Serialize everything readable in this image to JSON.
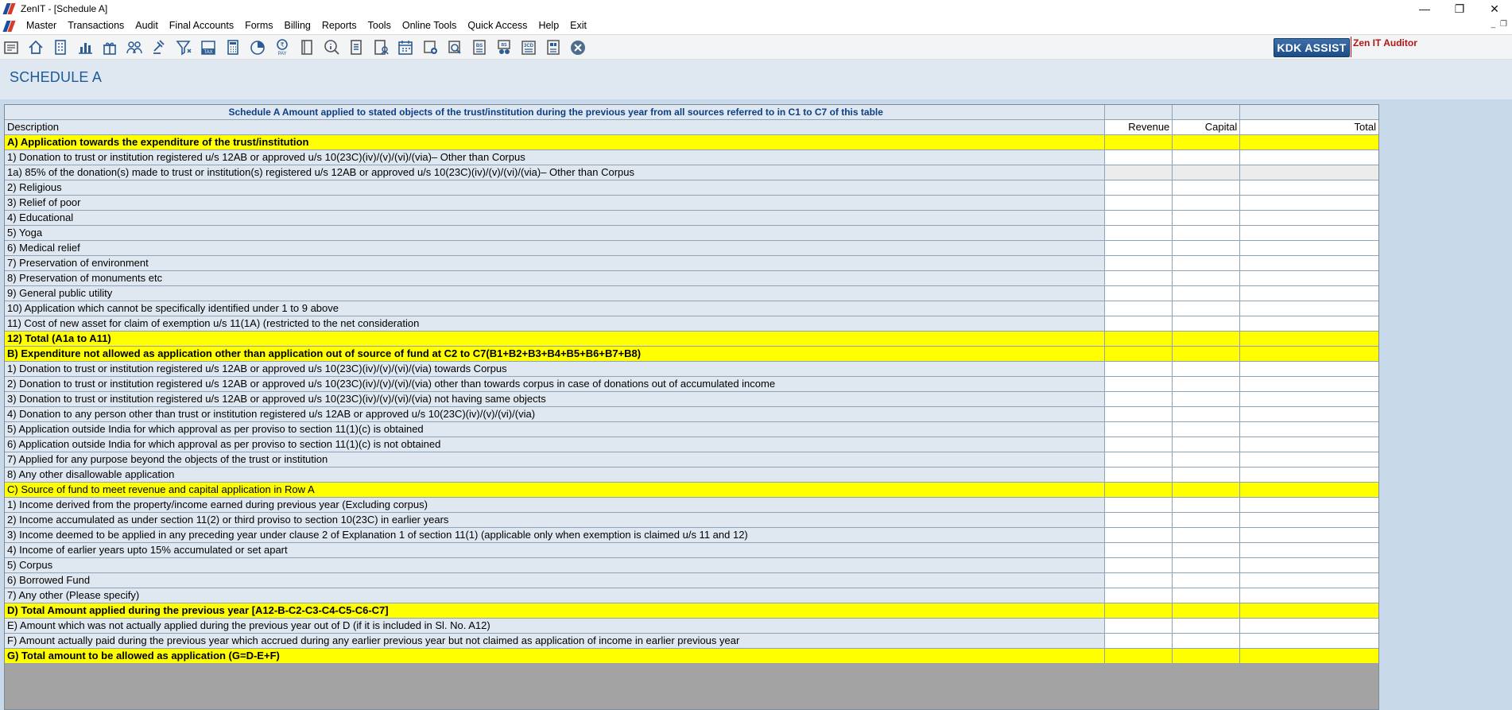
{
  "window": {
    "title": "ZenIT - [Schedule A]",
    "controls": {
      "minimize": "—",
      "restore": "❐",
      "close": "✕"
    }
  },
  "menu": {
    "items": [
      "Master",
      "Transactions",
      "Audit",
      "Final Accounts",
      "Forms",
      "Billing",
      "Reports",
      "Tools",
      "Online Tools",
      "Quick Access",
      "Help",
      "Exit"
    ],
    "mdi": {
      "minimize": "_",
      "restore": "❐"
    }
  },
  "toolbar": {
    "icons": [
      "open-icon",
      "home-icon",
      "building-icon",
      "chart-icon",
      "gift-icon",
      "people-icon",
      "gavel-icon",
      "filter-icon",
      "tax-icon",
      "calculator-icon",
      "pie-icon",
      "pay-icon",
      "book-icon",
      "info-icon",
      "report-icon",
      "user-doc-icon",
      "calendar-icon",
      "add-doc-icon",
      "search-doc-icon",
      "bs-icon",
      "tds-icon",
      "3cd-icon",
      "grid-doc-icon",
      "close-circle-icon"
    ],
    "kdk_label": "KDK ASSIST",
    "zen_label": "Zen IT Auditor"
  },
  "page": {
    "title": "SCHEDULE A"
  },
  "table": {
    "title": "Schedule A Amount applied to stated objects of the trust/institution during the previous year from all sources referred to in C1 to C7 of this table",
    "headers": {
      "description": "Description",
      "revenue": "Revenue",
      "capital": "Capital",
      "total": "Total"
    },
    "rows": [
      {
        "label": "A) Application towards the expenditure of the trust/institution",
        "style": "yellow"
      },
      {
        "label": "1) Donation to trust or institution registered u/s 12AB or approved u/s 10(23C)(iv)/(v)/(vi)/(via)– Other than Corpus",
        "style": "normal"
      },
      {
        "label": "1a) 85% of the donation(s) made to trust or institution(s) registered u/s 12AB or approved u/s  10(23C)(iv)/(v)/(vi)/(via)– Other than Corpus",
        "style": "grey"
      },
      {
        "label": "2) Religious",
        "style": "normal"
      },
      {
        "label": "3) Relief of poor",
        "style": "normal"
      },
      {
        "label": "4) Educational",
        "style": "normal"
      },
      {
        "label": "5) Yoga",
        "style": "normal"
      },
      {
        "label": "6) Medical relief",
        "style": "normal"
      },
      {
        "label": "7) Preservation of environment",
        "style": "normal"
      },
      {
        "label": "8) Preservation of monuments etc",
        "style": "normal"
      },
      {
        "label": "9) General public utility",
        "style": "normal"
      },
      {
        "label": "10) Application which cannot be specifically identified under 1 to 9 above",
        "style": "normal"
      },
      {
        "label": "11) Cost of new asset for claim of exemption u/s 11(1A) (restricted to the net consideration",
        "style": "normal"
      },
      {
        "label": "12) Total (A1a to A11)",
        "style": "yellow"
      },
      {
        "label": "B) Expenditure not allowed as application other than application out of source of fund at C2 to C7(B1+B2+B3+B4+B5+B6+B7+B8)",
        "style": "yellow"
      },
      {
        "label": "1) Donation to trust or institution registered u/s 12AB or approved u/s 10(23C)(iv)/(v)/(vi)/(via) towards Corpus",
        "style": "normal"
      },
      {
        "label": "2) Donation to trust or institution registered u/s 12AB or approved u/s 10(23C)(iv)/(v)/(vi)/(via) other than towards corpus in case of donations out of accumulated income",
        "style": "normal"
      },
      {
        "label": "3) Donation to trust or institution registered u/s 12AB or approved u/s 10(23C)(iv)/(v)/(vi)/(via) not having same objects",
        "style": "normal"
      },
      {
        "label": "4) Donation to any person other than trust or institution registered u/s 12AB or approved u/s 10(23C)(iv)/(v)/(vi)/(via)",
        "style": "normal"
      },
      {
        "label": "5) Application outside India for which approval as per proviso to section 11(1)(c) is obtained",
        "style": "normal"
      },
      {
        "label": "6) Application outside India for which approval as per proviso to section 11(1)(c) is not obtained",
        "style": "normal"
      },
      {
        "label": "7) Applied for any purpose beyond the objects of the trust or institution",
        "style": "normal"
      },
      {
        "label": "8) Any other disallowable application",
        "style": "normal"
      },
      {
        "label": "C) Source of fund to meet revenue and capital application in Row A",
        "style": "yellow-plain"
      },
      {
        "label": "1) Income derived from the property/income earned during previous year (Excluding corpus)",
        "style": "normal"
      },
      {
        "label": "2) Income accumulated as under section 11(2) or third proviso to section 10(23C) in earlier years",
        "style": "normal"
      },
      {
        "label": "3) Income deemed to be applied in any preceding year under clause 2 of Explanation 1 of section 11(1) (applicable only when exemption is claimed u/s 11 and 12)",
        "style": "normal"
      },
      {
        "label": "4) Income of earlier years upto 15% accumulated or set apart",
        "style": "normal"
      },
      {
        "label": "5) Corpus",
        "style": "normal"
      },
      {
        "label": "6) Borrowed Fund",
        "style": "normal"
      },
      {
        "label": "7) Any other (Please specify)",
        "style": "normal"
      },
      {
        "label": "D) Total Amount applied during the previous year [A12-B-C2-C3-C4-C5-C6-C7]",
        "style": "yellow"
      },
      {
        "label": "E) Amount which was not actually applied during the previous year out of D (if it is included in Sl. No. A12)",
        "style": "normal"
      },
      {
        "label": "F) Amount actually paid during the previous year which accrued during any earlier previous year but not claimed as application of income in earlier previous year",
        "style": "normal"
      },
      {
        "label": "G) Total amount to be allowed as application (G=D-E+F)",
        "style": "yellow"
      }
    ]
  },
  "colors": {
    "highlight": "#ffff00",
    "title_blue": "#1d5a9c",
    "row_bg": "#dfe8f1",
    "kdk_blue": "#1e4d86",
    "zen_red": "#b01616"
  }
}
